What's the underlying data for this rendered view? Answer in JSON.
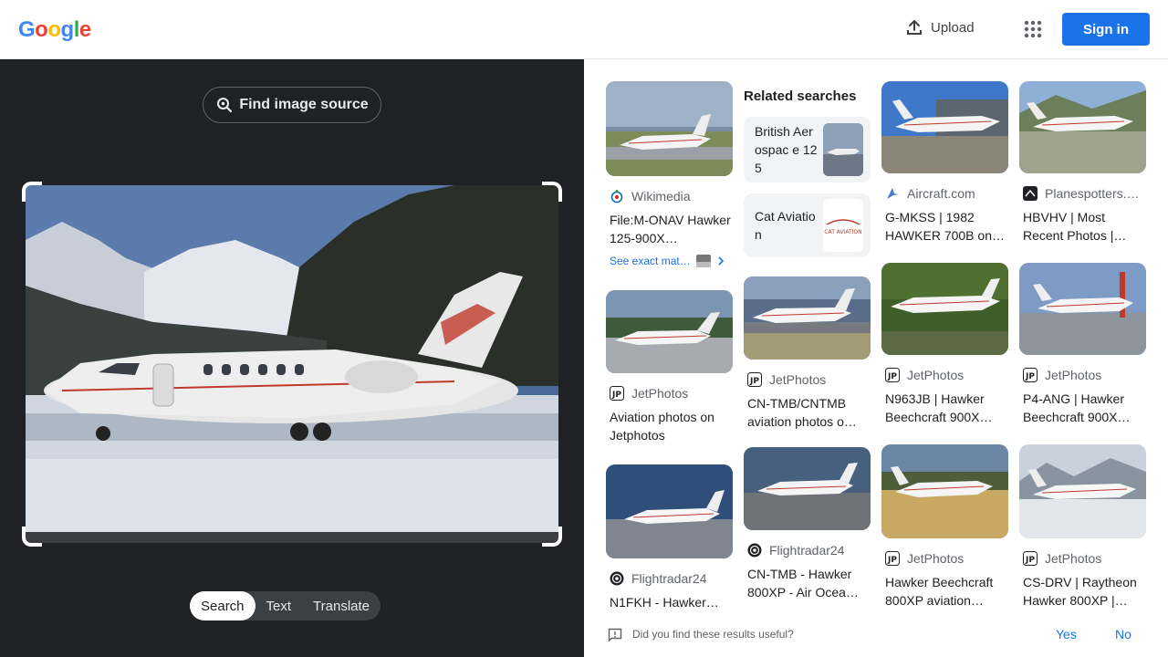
{
  "header": {
    "logo_letters": [
      {
        "ch": "G",
        "color": "#4285f4"
      },
      {
        "ch": "o",
        "color": "#ea4335"
      },
      {
        "ch": "o",
        "color": "#fbbc05"
      },
      {
        "ch": "g",
        "color": "#4285f4"
      },
      {
        "ch": "l",
        "color": "#34a853"
      },
      {
        "ch": "e",
        "color": "#ea4335"
      }
    ],
    "upload_label": "Upload",
    "signin_label": "Sign in"
  },
  "left": {
    "find_source_label": "Find image source",
    "tabs": [
      {
        "label": "Search",
        "active": true
      },
      {
        "label": "Text",
        "active": false
      },
      {
        "label": "Translate",
        "active": false
      }
    ]
  },
  "related": {
    "title": "Related searches",
    "items": [
      {
        "label": "British Aerospac e 125"
      },
      {
        "label": "Cat Aviation",
        "thumb_text": "CAT AVIATION"
      }
    ]
  },
  "columns": [
    [
      {
        "source": "Wikimedia",
        "icon": "wikimedia-icon",
        "title": "File:M-ONAV Hawker 125-900X…",
        "see_exact": "See exact mat…"
      },
      {
        "source": "JetPhotos",
        "icon": "jetphotos-icon",
        "title": "Aviation photos on Jetphotos"
      },
      {
        "source": "Flightradar24",
        "icon": "flightradar-icon",
        "title": "N1FKH - Hawker…"
      }
    ],
    [
      {
        "source": "JetPhotos",
        "icon": "jetphotos-icon",
        "title": "CN-TMB/CNTMB aviation photos o…"
      },
      {
        "source": "Flightradar24",
        "icon": "flightradar-icon",
        "title": "CN-TMB - Hawker 800XP - Air Ocea…"
      }
    ],
    [
      {
        "source": "Aircraft.com",
        "icon": "aircraft-icon",
        "title": "G-MKSS | 1982 HAWKER 700B on…"
      },
      {
        "source": "JetPhotos",
        "icon": "jetphotos-icon",
        "title": "N963JB | Hawker Beechcraft 900X…"
      },
      {
        "source": "JetPhotos",
        "icon": "jetphotos-icon",
        "title": "Hawker Beechcraft 800XP aviation…"
      }
    ],
    [
      {
        "source": "Planespotters.…",
        "icon": "planespotters-icon",
        "title": "HBVHV | Most Recent Photos |…"
      },
      {
        "source": "JetPhotos",
        "icon": "jetphotos-icon",
        "title": "P4-ANG | Hawker Beechcraft 900X…"
      },
      {
        "source": "JetPhotos",
        "icon": "jetphotos-icon",
        "title": "CS-DRV | Raytheon Hawker 800XP |…"
      }
    ]
  ],
  "feedback": {
    "question": "Did you find these results useful?",
    "yes": "Yes",
    "no": "No"
  }
}
